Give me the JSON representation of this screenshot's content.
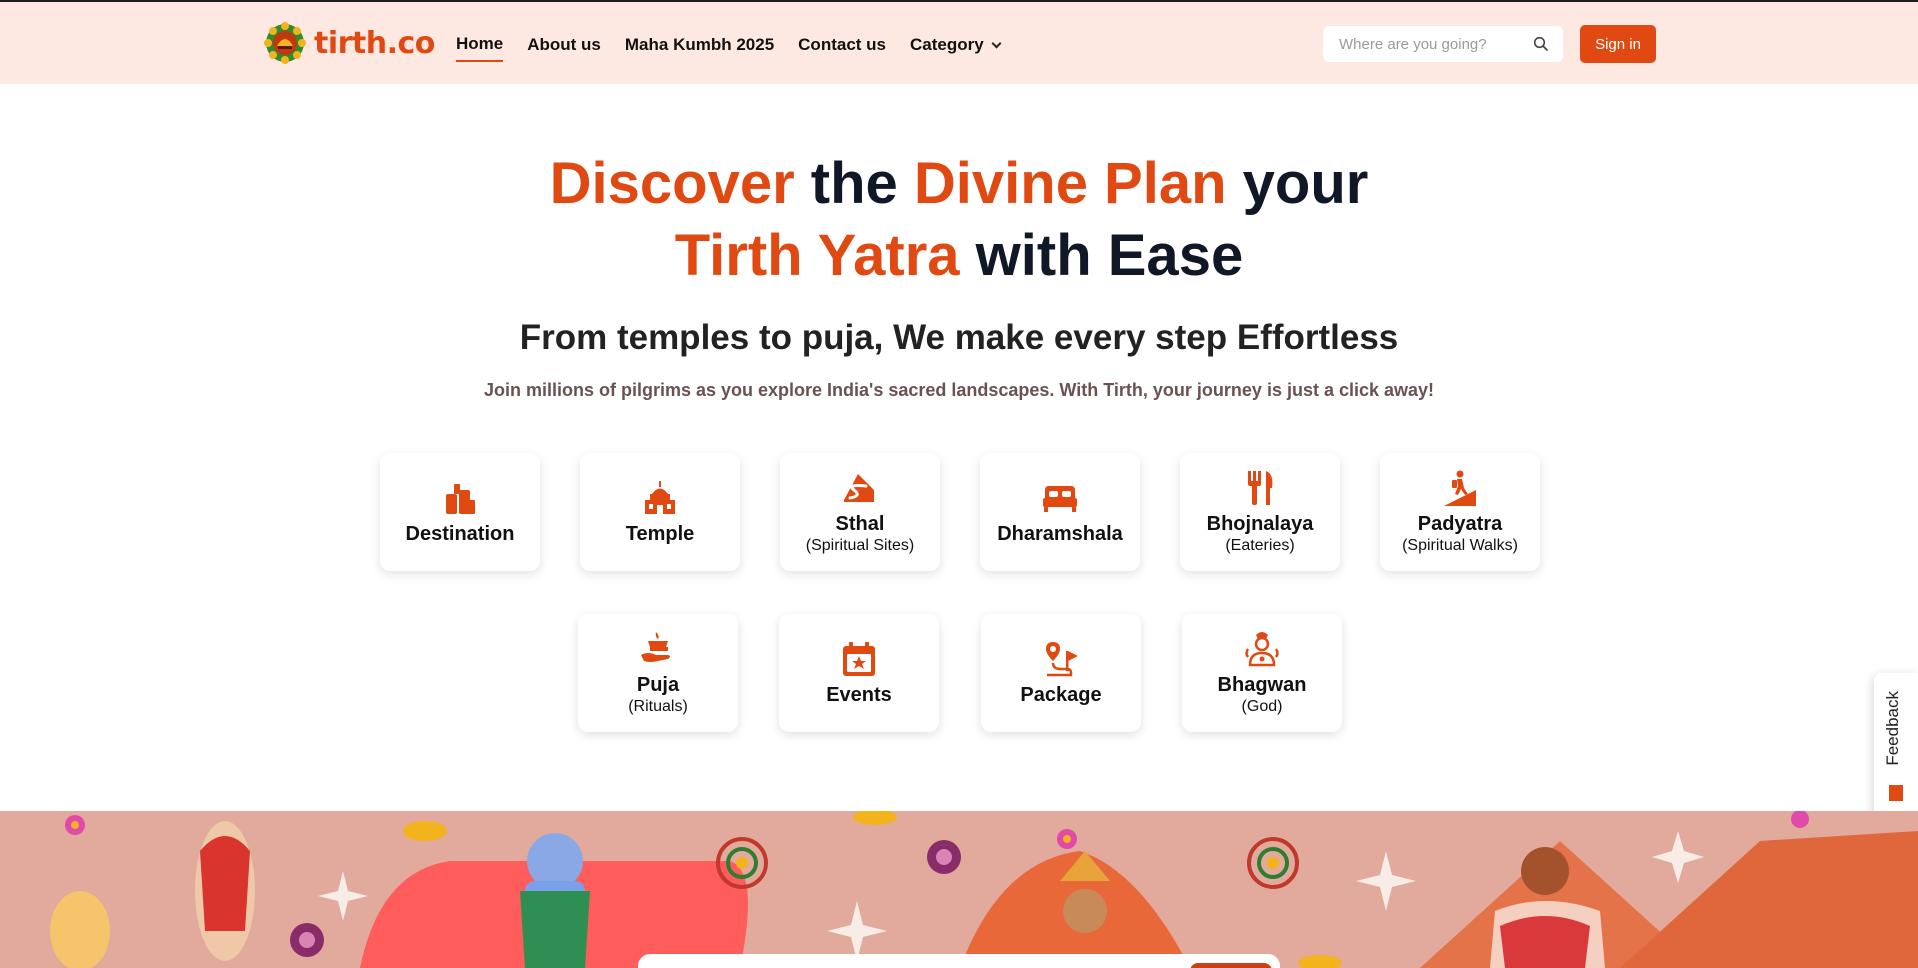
{
  "brand": {
    "name": "tirth.co",
    "accent": "#e04a12"
  },
  "nav": {
    "items": [
      {
        "label": "Home",
        "active": true
      },
      {
        "label": "About us"
      },
      {
        "label": "Maha Kumbh 2025"
      },
      {
        "label": "Contact us"
      },
      {
        "label": "Category",
        "dropdown": true
      }
    ]
  },
  "search": {
    "placeholder": "Where are you going?",
    "icon": "search-icon"
  },
  "auth": {
    "signin_label": "Sign in"
  },
  "hero": {
    "title_parts": [
      "Discover",
      " the ",
      "Divine Plan",
      " your",
      "Tirth Yatra",
      " with Ease"
    ],
    "subtitle": "From temples to puja, We make every step Effortless",
    "description": "Join millions of pilgrims as you explore India's sacred landscapes. With Tirth, your journey is just a click away!"
  },
  "categories": [
    {
      "label": "Destination",
      "sub": "",
      "icon": "destination-icon"
    },
    {
      "label": "Temple",
      "sub": "",
      "icon": "temple-icon"
    },
    {
      "label": "Sthal",
      "sub": "(Spiritual Sites)",
      "icon": "sthal-icon"
    },
    {
      "label": "Dharamshala",
      "sub": "",
      "icon": "bed-icon"
    },
    {
      "label": "Bhojnalaya",
      "sub": "(Eateries)",
      "icon": "fork-knife-icon"
    },
    {
      "label": "Padyatra",
      "sub": "(Spiritual Walks)",
      "icon": "hiker-icon"
    },
    {
      "label": "Puja",
      "sub": "(Rituals)",
      "icon": "puja-icon"
    },
    {
      "label": "Events",
      "sub": "",
      "icon": "calendar-icon"
    },
    {
      "label": "Package",
      "sub": "",
      "icon": "route-flag-icon"
    },
    {
      "label": "Bhagwan",
      "sub": "(God)",
      "icon": "deity-icon"
    }
  ],
  "feedback": {
    "label": "Feedback"
  }
}
